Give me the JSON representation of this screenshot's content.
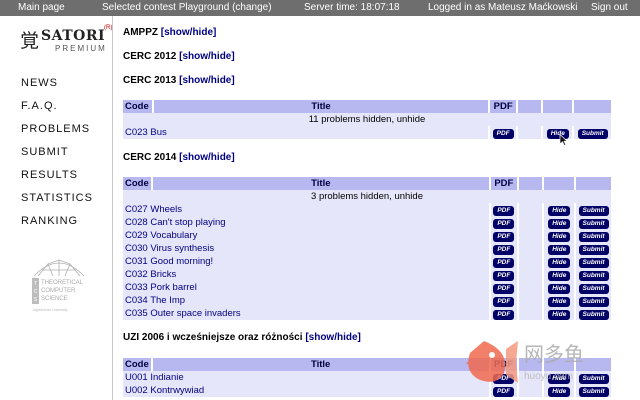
{
  "topbar": {
    "main_page": "Main page",
    "contest": "Selected contest Playground (change)",
    "server_time": "Server time: 18:07:18",
    "logged_in": "Logged in as Mateusz Maćkowski",
    "sign_out": "Sign out"
  },
  "logo": {
    "kanji": "覚",
    "name": "SATORI",
    "reg": "(R)",
    "premium": "PREMIUM"
  },
  "nav": [
    "NEWS",
    "F.A.Q.",
    "PROBLEMS",
    "SUBMIT",
    "RESULTS",
    "STATISTICS",
    "RANKING"
  ],
  "tcs_logo": {
    "line1": "THEORETICAL",
    "line2": "COMPUTER",
    "line3": "SCIENCE",
    "line4": "Jagiellonian University"
  },
  "sections": {
    "amppz": {
      "title": "AMPPZ",
      "toggle": "[show/hide]"
    },
    "cerc2012": {
      "title": "CERC 2012",
      "toggle": "[show/hide]"
    },
    "cerc2013": {
      "title": "CERC 2013",
      "toggle": "[show/hide]"
    },
    "cerc2014": {
      "title": "CERC 2014",
      "toggle": "[show/hide]"
    },
    "uzi": {
      "title": "UZI 2006 i wcześniejsze oraz różności",
      "toggle": "[show/hide]"
    }
  },
  "table_headers": {
    "code": "Code",
    "title": "Title",
    "pdf": "PDF"
  },
  "buttons": {
    "pdf": "PDF",
    "hide": "Hide",
    "submit": "Submit"
  },
  "cerc2013": {
    "hidden_note": "11 problems hidden, unhide",
    "rows": [
      {
        "code": "C023",
        "title": "Bus"
      }
    ]
  },
  "cerc2014": {
    "hidden_note": "3 problems hidden, unhide",
    "rows": [
      {
        "code": "C027",
        "title": "Wheels"
      },
      {
        "code": "C028",
        "title": "Can't stop playing"
      },
      {
        "code": "C029",
        "title": "Vocabulary"
      },
      {
        "code": "C030",
        "title": "Virus synthesis"
      },
      {
        "code": "C031",
        "title": "Good morning!"
      },
      {
        "code": "C032",
        "title": "Bricks"
      },
      {
        "code": "C033",
        "title": "Pork barrel"
      },
      {
        "code": "C034",
        "title": "The Imp"
      },
      {
        "code": "C035",
        "title": "Outer space invaders"
      }
    ]
  },
  "uzi": {
    "rows": [
      {
        "code": "U001",
        "title": "Indianie"
      },
      {
        "code": "U002",
        "title": "Kontrwywiad"
      }
    ]
  },
  "watermark": {
    "cn": "网多鱼",
    "url": "huoyu.com"
  },
  "colors": {
    "header_bg": "#b8b8f0",
    "row_bg": "#e6e6fb",
    "button": "#000066",
    "topbar": "#6e6e6e",
    "link": "#000080"
  }
}
